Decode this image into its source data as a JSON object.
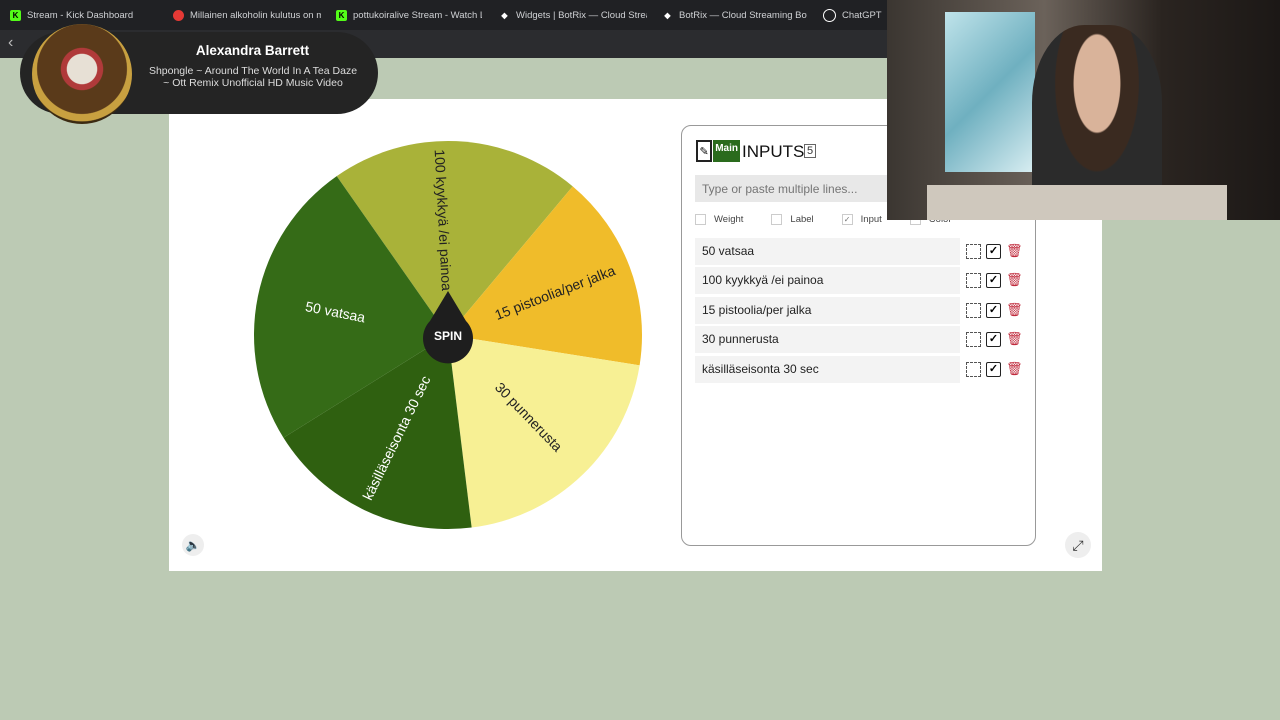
{
  "browser": {
    "tabs": [
      {
        "title": "Stream - Kick Dashboard",
        "icon": "kick-icon",
        "color": "#53fc18"
      },
      {
        "title": "Millainen alkoholin kulutus on maksa",
        "icon": "youtube-icon",
        "color": "#e53935"
      },
      {
        "title": "pottukoiralive Stream - Watch Live",
        "icon": "kick-icon",
        "color": "#53fc18"
      },
      {
        "title": "Widgets | BotRix — Cloud Streaming",
        "icon": "botrix-icon",
        "color": "#ffffff"
      },
      {
        "title": "BotRix — Cloud Streaming Bot f",
        "icon": "botrix-icon",
        "color": "#ffffff"
      },
      {
        "title": "ChatGPT",
        "icon": "chatgpt-icon",
        "color": "#ffffff"
      }
    ]
  },
  "now_playing": {
    "artist": "Alexandra Barrett",
    "song": "Shpongle ~ Around The World In A Tea Daze ~ Ott Remix Unofficial HD Music Video"
  },
  "wheel": {
    "spin_label": "SPIN",
    "segments": [
      {
        "label": "100 kyykkyä /ei painoa",
        "color": "#a9b239"
      },
      {
        "label": "15 pistoolia/per jalka",
        "color": "#f0bc2a"
      },
      {
        "label": "30 punnerusta",
        "color": "#f7f094"
      },
      {
        "label": "käsilläseisonta 30 sec",
        "color": "#2f6010"
      },
      {
        "label": "50 vatsaa",
        "color": "#356b17"
      }
    ]
  },
  "inputs_panel": {
    "logo_text": "Main",
    "title": "INPUTS",
    "count": "5",
    "placeholder": "Type or paste multiple lines...",
    "options": [
      {
        "label": "Weight",
        "checked": false
      },
      {
        "label": "Label",
        "checked": false
      },
      {
        "label": "Input",
        "checked": true
      },
      {
        "label": "Color",
        "checked": false
      }
    ],
    "rows": [
      "50 vatsaa",
      "100 kyykkyä /ei painoa",
      "15 pistoolia/per jalka",
      "30 punnerusta",
      "käsilläseisonta 30 sec"
    ]
  }
}
